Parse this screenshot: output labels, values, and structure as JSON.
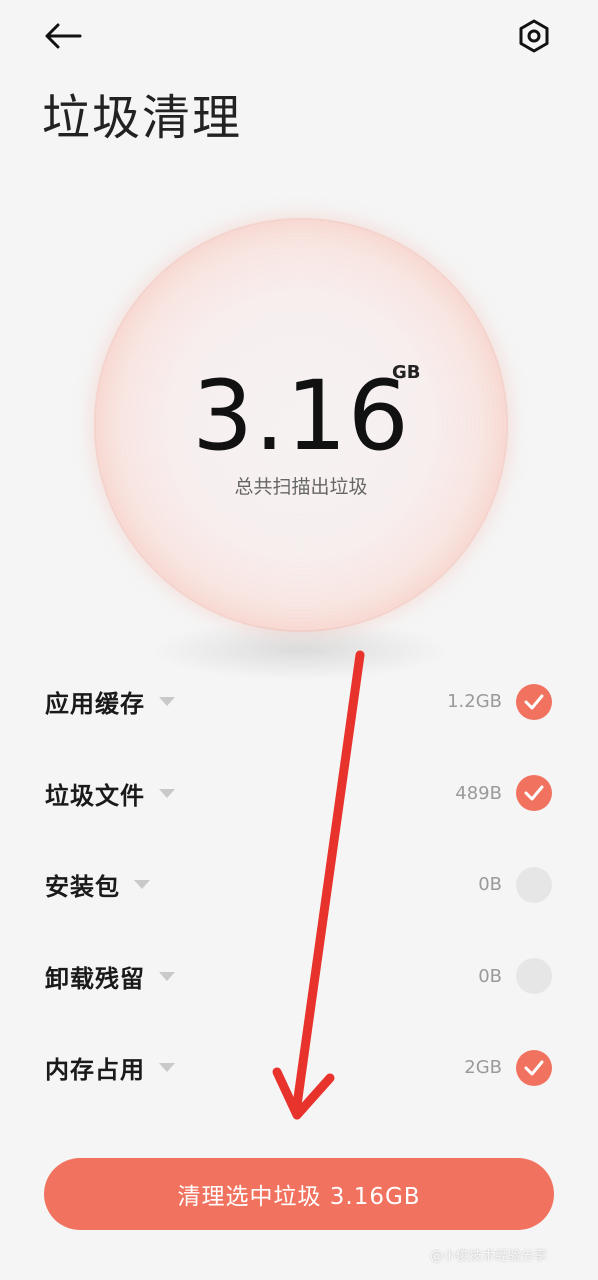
{
  "header": {
    "back_icon": "arrow-left-icon",
    "settings_icon": "gear-icon",
    "title": "垃圾清理"
  },
  "summary": {
    "value": "3.16",
    "unit": "GB",
    "caption": "总共扫描出垃圾"
  },
  "items": [
    {
      "label": "应用缓存",
      "size": "1.2GB",
      "checked": true
    },
    {
      "label": "垃圾文件",
      "size": "489B",
      "checked": true
    },
    {
      "label": "安装包",
      "size": "0B",
      "checked": false
    },
    {
      "label": "卸载残留",
      "size": "0B",
      "checked": false
    },
    {
      "label": "内存占用",
      "size": "2GB",
      "checked": true
    }
  ],
  "action": {
    "clean_label": "清理选中垃圾 3.16GB"
  },
  "watermark": "@小俊技术经验分享",
  "colors": {
    "accent": "#f1735f",
    "annotation": "#e8322c"
  }
}
